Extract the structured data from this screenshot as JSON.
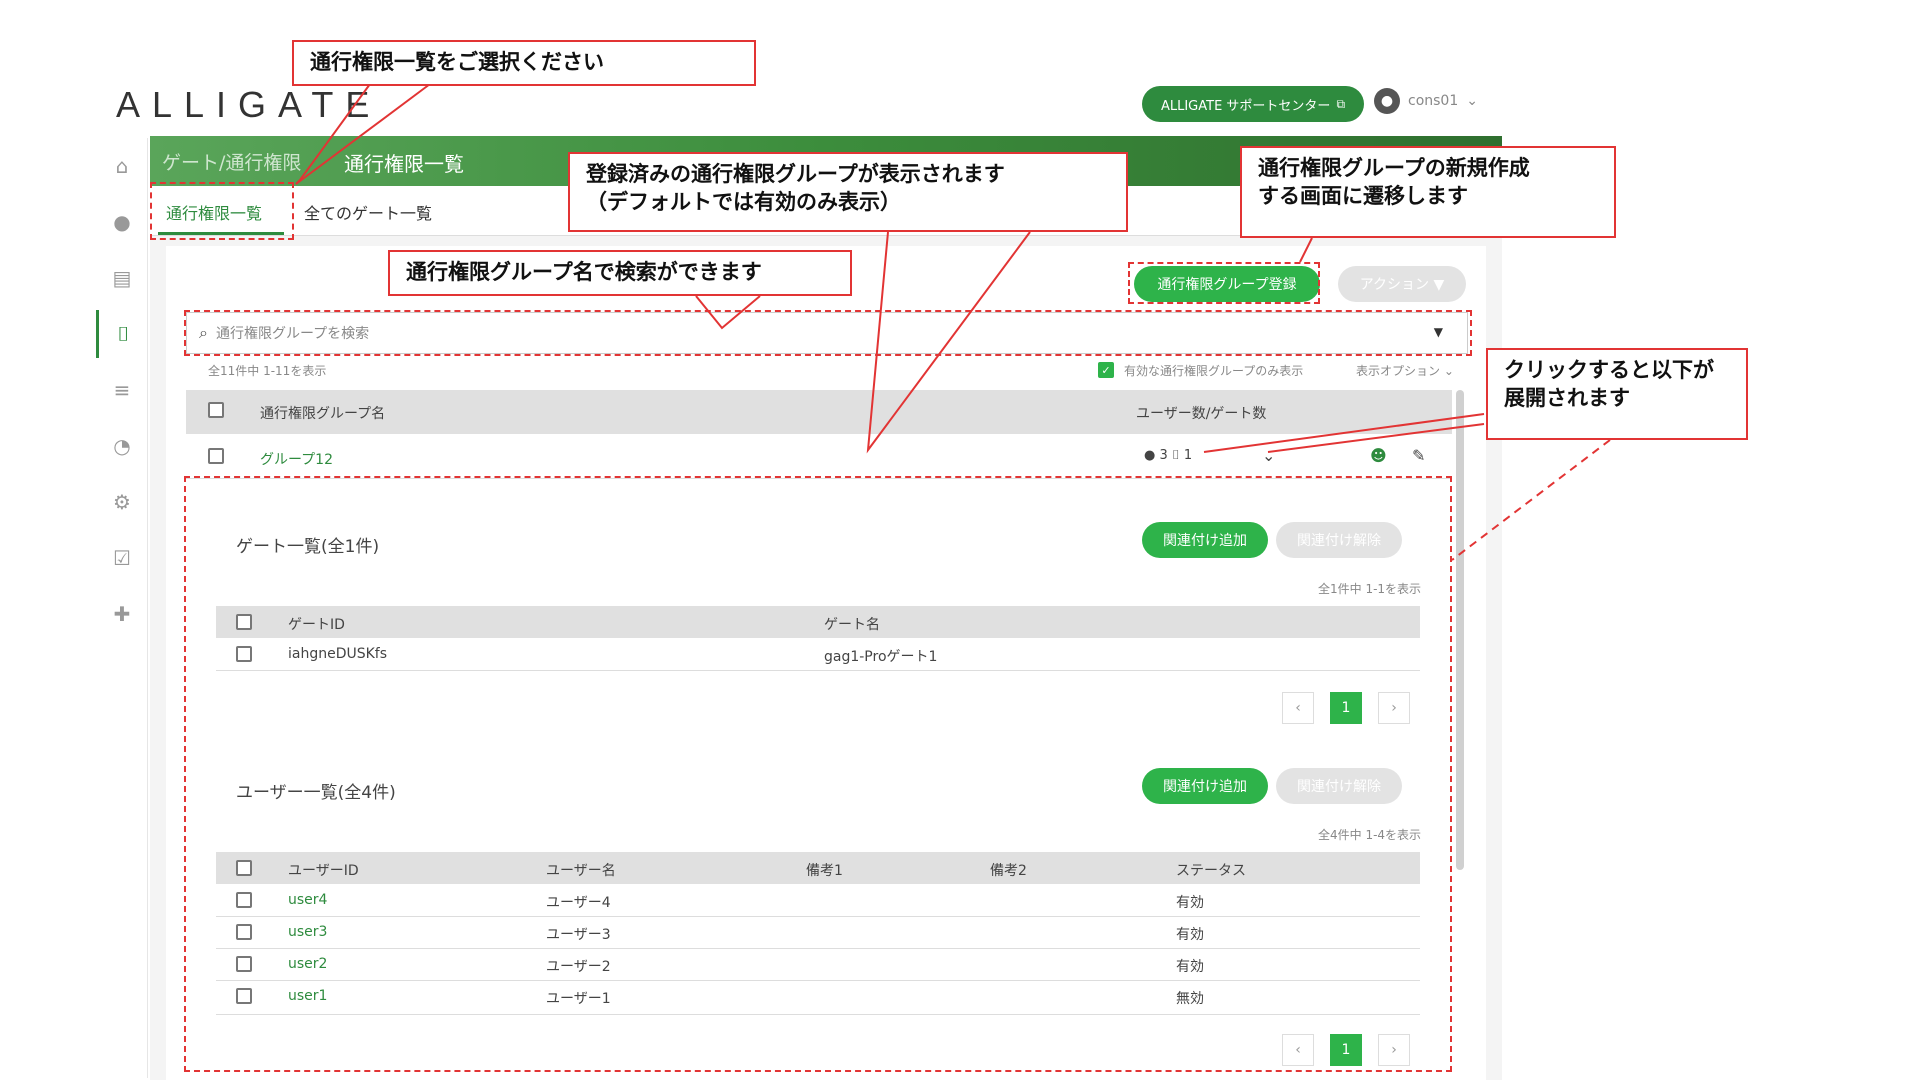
{
  "app": {
    "logo": "ALLIGATE",
    "support_button": "ALLIGATE サポートセンター",
    "user_name": "cons01"
  },
  "header": {
    "breadcrumb": "ゲート/通行権限",
    "title": "通行権限一覧"
  },
  "tabs": [
    "通行権限一覧",
    "全てのゲート一覧"
  ],
  "sidebar": {
    "items": [
      "home-icon",
      "person-icon",
      "id-card-icon",
      "door-icon",
      "list-icon",
      "user-clock-icon",
      "gear-icon",
      "checkbox-icon",
      "puzzle-icon"
    ]
  },
  "toolbar": {
    "register_button": "通行権限グループ登録",
    "action_button": "アクション ▼"
  },
  "search": {
    "placeholder": "通行権限グループを検索"
  },
  "summary": {
    "count_text": "全11件中 1-11を表示",
    "active_only": "有効な通行権限グループのみ表示",
    "display_options": "表示オプション"
  },
  "group_table": {
    "headers": [
      "通行権限グループ名",
      "ユーザー数/ゲート数"
    ],
    "row": {
      "name": "グループ12",
      "users": "3",
      "gates": "1"
    }
  },
  "gates_section": {
    "title": "ゲート一覧(全1件)",
    "add_button": "関連付け追加",
    "remove_button": "関連付け解除",
    "count_text": "全1件中 1-1を表示",
    "headers": [
      "ゲートID",
      "ゲート名"
    ],
    "rows": [
      {
        "id": "iahgneDUSKfs",
        "name": "gag1-Proゲート1"
      }
    ],
    "page": "1"
  },
  "users_section": {
    "title": "ユーザー一覧(全4件)",
    "add_button": "関連付け追加",
    "remove_button": "関連付け解除",
    "count_text": "全4件中 1-4を表示",
    "headers": [
      "ユーザーID",
      "ユーザー名",
      "備考1",
      "備考2",
      "ステータス"
    ],
    "rows": [
      {
        "id": "user4",
        "name": "ユーザー4",
        "status": "有効"
      },
      {
        "id": "user3",
        "name": "ユーザー3",
        "status": "有効"
      },
      {
        "id": "user2",
        "name": "ユーザー2",
        "status": "有効"
      },
      {
        "id": "user1",
        "name": "ユーザー1",
        "status": "無効"
      }
    ],
    "page": "1"
  },
  "annotations": {
    "select_list": "通行権限一覧をご選択ください",
    "registered_groups": [
      "登録済みの通行権限グループが表示されます",
      "（デフォルトでは有効のみ表示）"
    ],
    "new_group": [
      "通行権限グループの新規作成",
      "する画面に遷移します"
    ],
    "search_hint": "通行権限グループ名で検索ができます",
    "expand_hint": [
      "クリックすると以下が",
      "展開されます"
    ]
  },
  "colors": {
    "accent": "#2e8b3e",
    "button_green": "#2eb34a",
    "annotation_red": "#e23434"
  }
}
